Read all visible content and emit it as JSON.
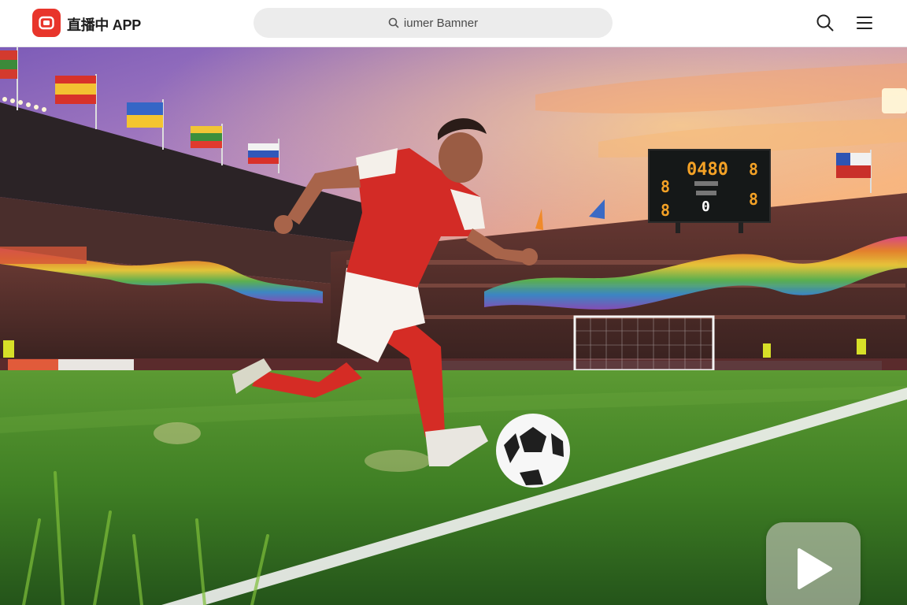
{
  "app": {
    "name": "直播中 APP",
    "logo_icon": "live-app-logo-icon",
    "brand_color": "#e8352b"
  },
  "search": {
    "placeholder": "iumer Bamner",
    "icon": "search-icon"
  },
  "header_actions": {
    "search_icon": "search-icon",
    "menu_icon": "hamburger-menu-icon"
  },
  "banner": {
    "scene": "soccer player kicking ball in stadium at sunset",
    "scoreboard": {
      "top": "0480",
      "left_score_1": "8",
      "right_score_1": "8",
      "left_score_2": "8",
      "middle": "0",
      "right_score_2": "8"
    },
    "play_button_icon": "play-icon"
  }
}
